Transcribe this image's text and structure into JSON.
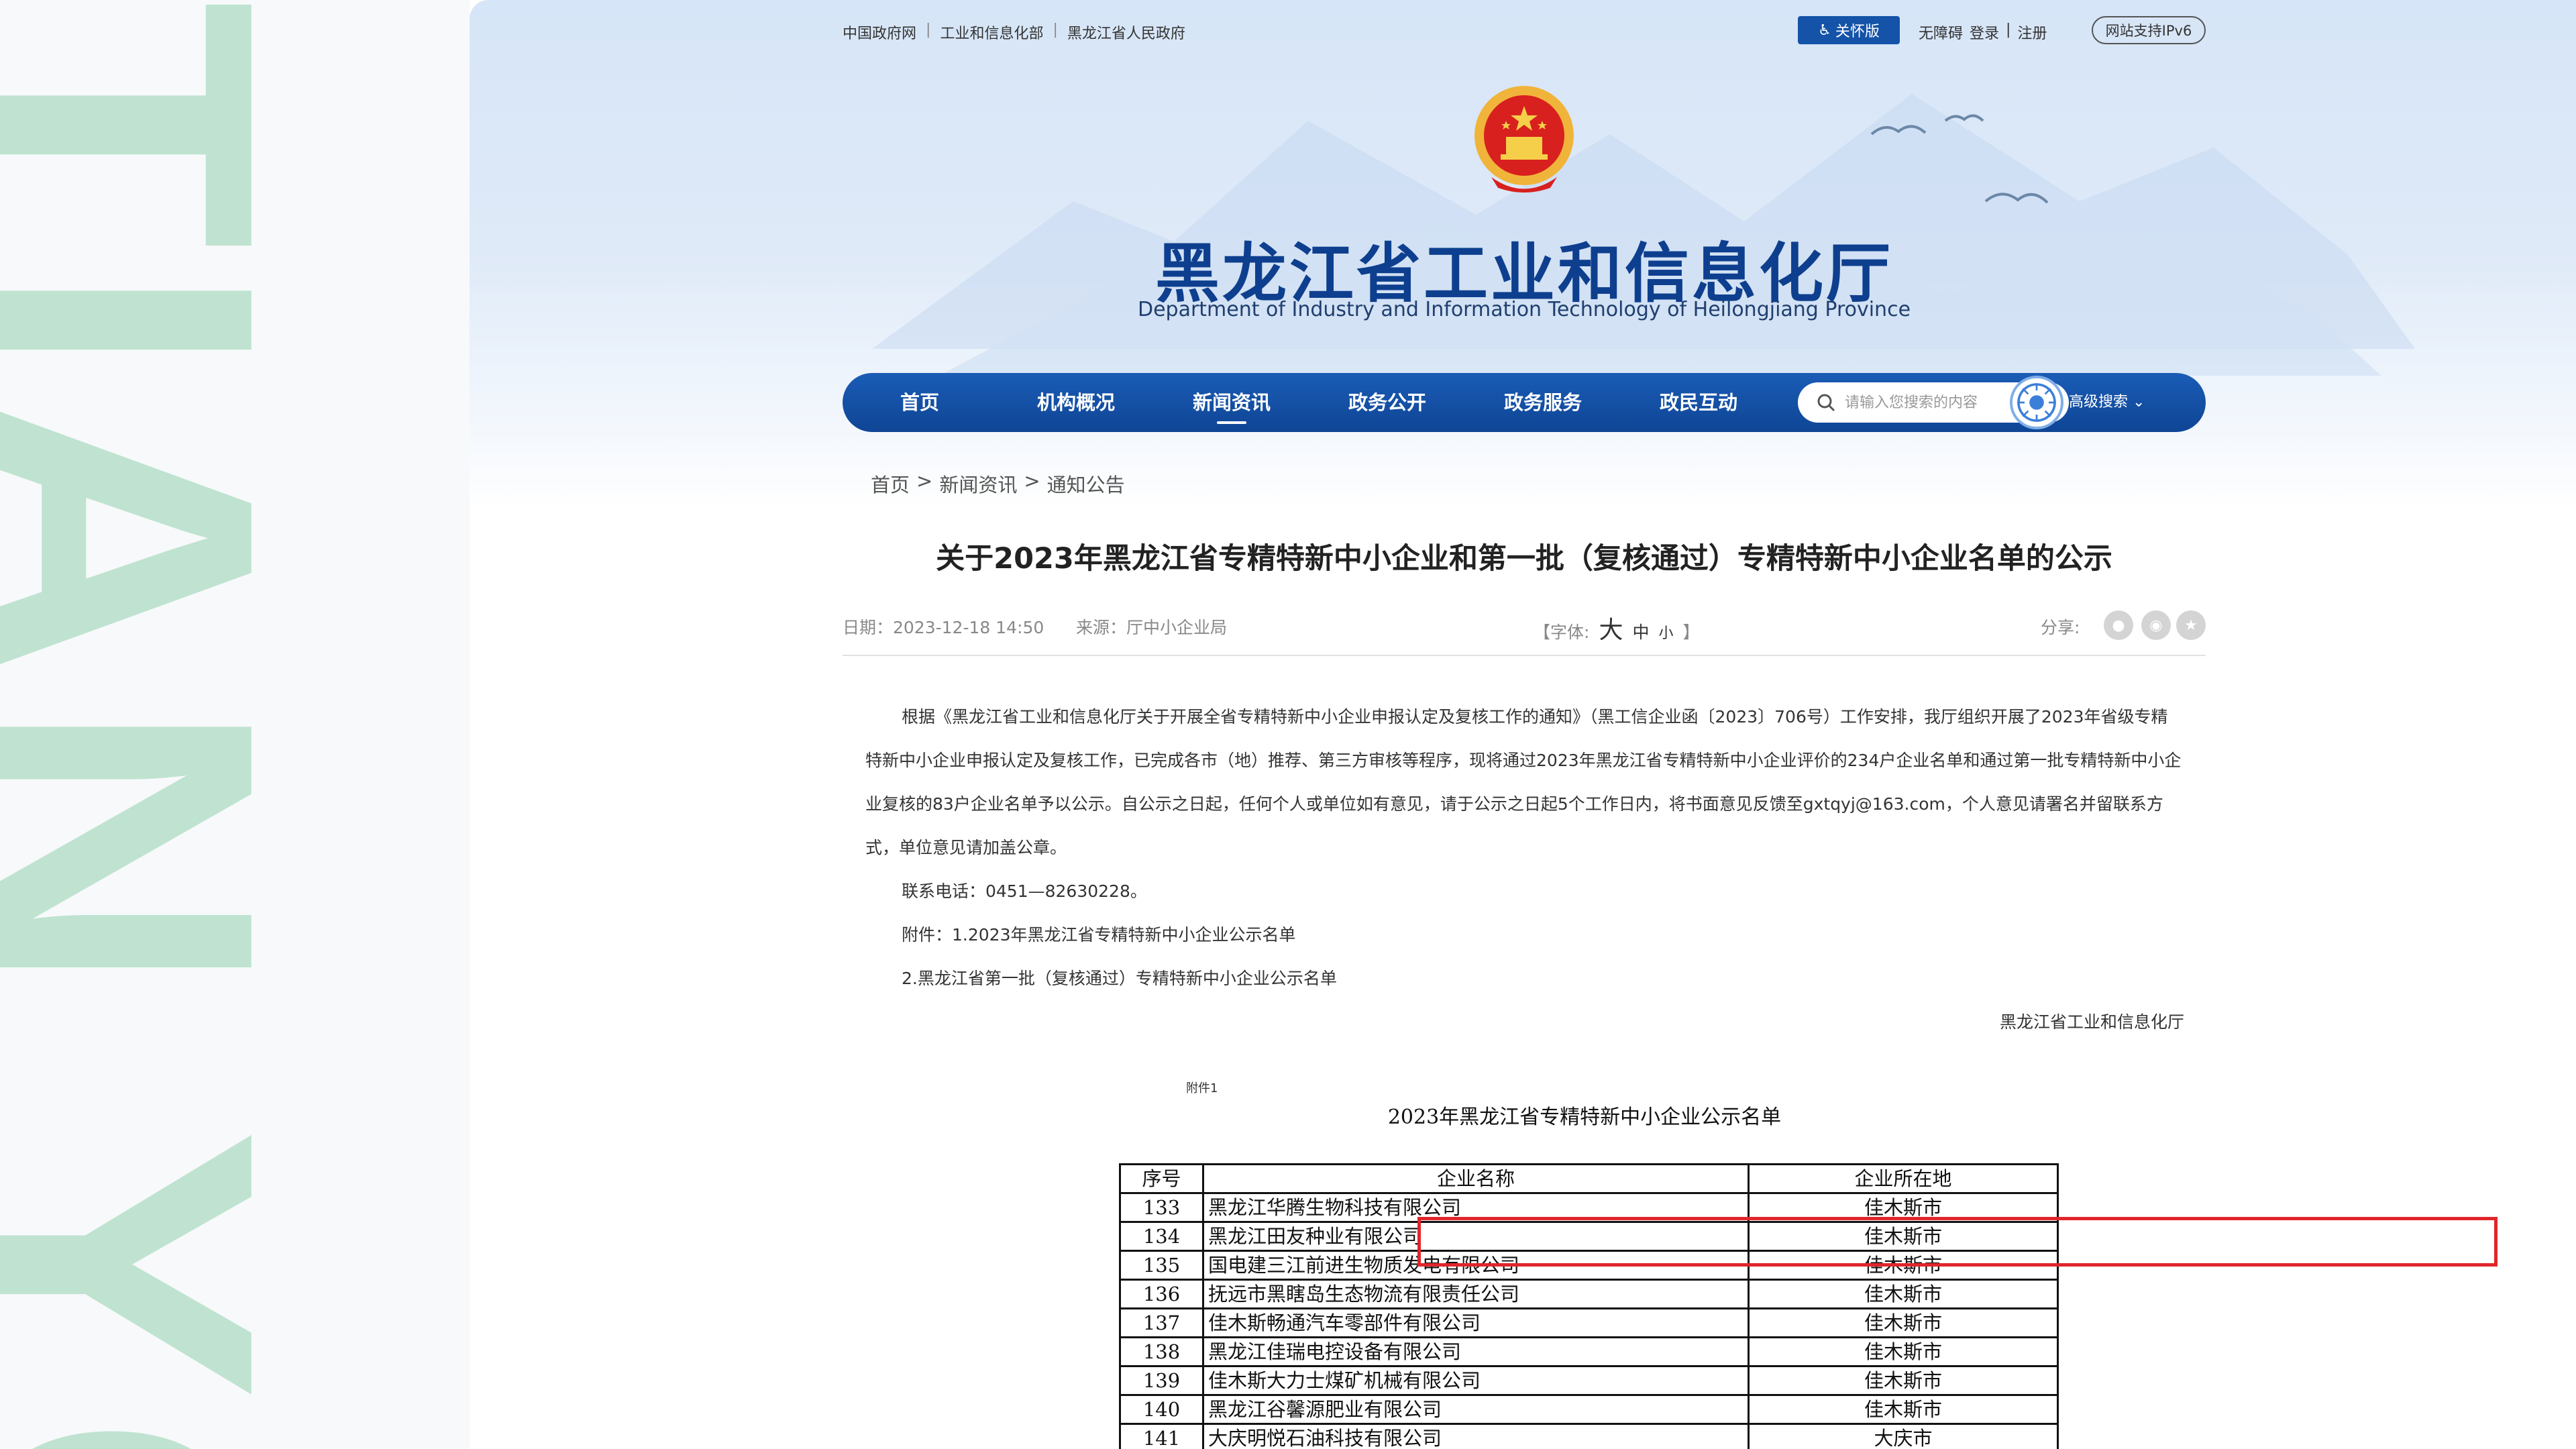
{
  "left_panel": {
    "vertical_text": "TIAN YOU"
  },
  "topbar": {
    "links": [
      "中国政府网",
      "工业和信息化部",
      "黑龙江省人民政府"
    ],
    "care_button": "关怀版",
    "accessibility": "无障碍",
    "login": "登录",
    "register": "注册",
    "ipv6": "网站支持IPv6"
  },
  "header": {
    "title": "黑龙江省工业和信息化厅",
    "subtitle": "Department of Industry and Information Technology of Heilongjiang Province"
  },
  "nav": {
    "items": [
      "首页",
      "机构概况",
      "新闻资讯",
      "政务公开",
      "政务服务",
      "政民互动"
    ],
    "active": "新闻资讯",
    "search_placeholder": "请输入您搜索的内容",
    "advanced_search": "高级搜索"
  },
  "breadcrumb": [
    "首页",
    "新闻资讯",
    "通知公告"
  ],
  "article": {
    "title": "关于2023年黑龙江省专精特新中小企业和第一批（复核通过）专精特新中小企业名单的公示",
    "date": "日期：2023-12-18 14:50",
    "source": "来源：厅中小企业局",
    "font_label_open": "【字体:",
    "font_large": "大",
    "font_medium": "中",
    "font_small": "小",
    "font_label_close": "】",
    "share_label": "分享:",
    "paragraphs": [
      "根据《黑龙江省工业和信息化厅关于开展全省专精特新中小企业申报认定及复核工作的通知》（黑工信企业函〔2023〕706号）工作安排，我厅组织开展了2023年省级专精特新中小企业申报认定及复核工作，已完成各市（地）推荐、第三方审核等程序，现将通过2023年黑龙江省专精特新中小企业评价的234户企业名单和通过第一批专精特新中小企业复核的83户企业名单予以公示。自公示之日起，任何个人或单位如有意见，请于公示之日起5个工作日内，将书面意见反馈至gxtqyj@163.com，个人意见请署名并留联系方式，单位意见请加盖公章。"
    ],
    "contact": "联系电话：0451—82630228。",
    "attachment_1": "附件：1.2023年黑龙江省专精特新中小企业公示名单",
    "attachment_2": "2.黑龙江省第一批（复核通过）专精特新中小企业公示名单",
    "signature": "黑龙江省工业和信息化厅"
  },
  "document": {
    "attach_label": "附件1",
    "title": "2023年黑龙江省专精特新中小企业公示名单",
    "headers": [
      "序号",
      "企业名称",
      "企业所在地"
    ],
    "rows": [
      [
        "133",
        "黑龙江华腾生物科技有限公司",
        "佳木斯市"
      ],
      [
        "134",
        "黑龙江田友种业有限公司",
        "佳木斯市"
      ],
      [
        "135",
        "国电建三江前进生物质发电有限公司",
        "佳木斯市"
      ],
      [
        "136",
        "抚远市黑瞎岛生态物流有限责任公司",
        "佳木斯市"
      ],
      [
        "137",
        "佳木斯畅通汽车零部件有限公司",
        "佳木斯市"
      ],
      [
        "138",
        "黑龙江佳瑞电控设备有限公司",
        "佳木斯市"
      ],
      [
        "139",
        "佳木斯大力士煤矿机械有限公司",
        "佳木斯市"
      ],
      [
        "140",
        "黑龙江谷馨源肥业有限公司",
        "佳木斯市"
      ],
      [
        "141",
        "大庆明悦石油科技有限公司",
        "大庆市"
      ]
    ],
    "highlighted_row": "134"
  },
  "colors": {
    "nav_blue": "#1453a8",
    "title_blue": "#0e3f8f",
    "highlight_red": "#e0262b",
    "left_text_green": "#bfe3d0"
  }
}
